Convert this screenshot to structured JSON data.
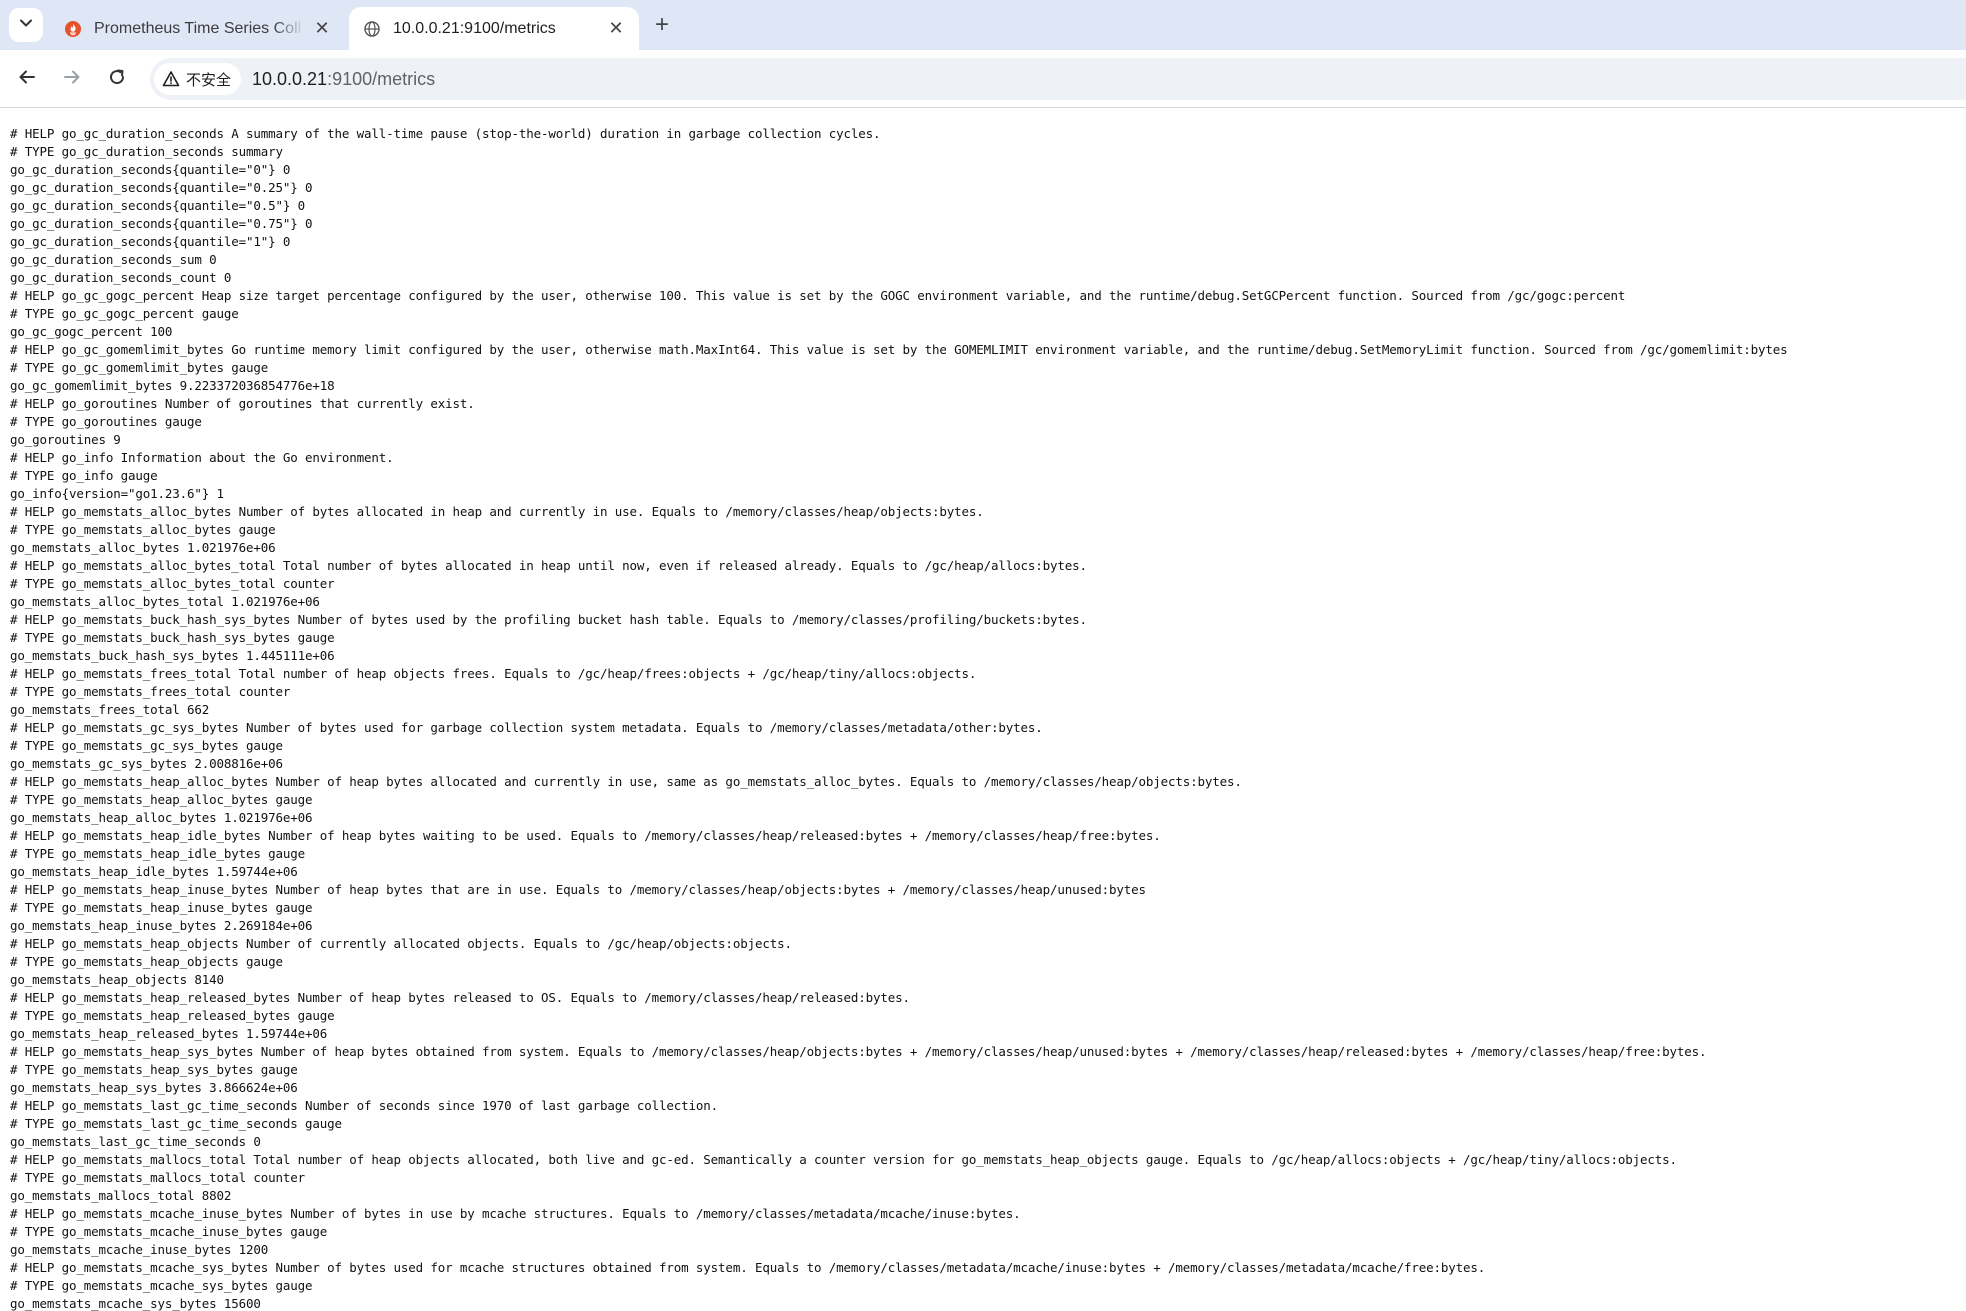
{
  "tabs": {
    "search_icon": "chevron-down-icon",
    "items": [
      {
        "title": "Prometheus Time Series Coll",
        "icon": "prometheus-flame-icon",
        "active": false
      },
      {
        "title": "10.0.0.21:9100/metrics",
        "icon": "globe-icon",
        "active": true
      }
    ],
    "close_glyph": "✕",
    "new_tab_glyph": "+"
  },
  "toolbar": {
    "back_icon": "arrow-left-icon",
    "forward_icon": "arrow-right-icon",
    "reload_icon": "reload-icon",
    "security_label": "不安全",
    "url_host": "10.0.0.21",
    "url_path": ":9100/metrics"
  },
  "page": {
    "lines": [
      "# HELP go_gc_duration_seconds A summary of the wall-time pause (stop-the-world) duration in garbage collection cycles.",
      "# TYPE go_gc_duration_seconds summary",
      "go_gc_duration_seconds{quantile=\"0\"} 0",
      "go_gc_duration_seconds{quantile=\"0.25\"} 0",
      "go_gc_duration_seconds{quantile=\"0.5\"} 0",
      "go_gc_duration_seconds{quantile=\"0.75\"} 0",
      "go_gc_duration_seconds{quantile=\"1\"} 0",
      "go_gc_duration_seconds_sum 0",
      "go_gc_duration_seconds_count 0",
      "# HELP go_gc_gogc_percent Heap size target percentage configured by the user, otherwise 100. This value is set by the GOGC environment variable, and the runtime/debug.SetGCPercent function. Sourced from /gc/gogc:percent",
      "# TYPE go_gc_gogc_percent gauge",
      "go_gc_gogc_percent 100",
      "# HELP go_gc_gomemlimit_bytes Go runtime memory limit configured by the user, otherwise math.MaxInt64. This value is set by the GOMEMLIMIT environment variable, and the runtime/debug.SetMemoryLimit function. Sourced from /gc/gomemlimit:bytes",
      "# TYPE go_gc_gomemlimit_bytes gauge",
      "go_gc_gomemlimit_bytes 9.223372036854776e+18",
      "# HELP go_goroutines Number of goroutines that currently exist.",
      "# TYPE go_goroutines gauge",
      "go_goroutines 9",
      "# HELP go_info Information about the Go environment.",
      "# TYPE go_info gauge",
      "go_info{version=\"go1.23.6\"} 1",
      "# HELP go_memstats_alloc_bytes Number of bytes allocated in heap and currently in use. Equals to /memory/classes/heap/objects:bytes.",
      "# TYPE go_memstats_alloc_bytes gauge",
      "go_memstats_alloc_bytes 1.021976e+06",
      "# HELP go_memstats_alloc_bytes_total Total number of bytes allocated in heap until now, even if released already. Equals to /gc/heap/allocs:bytes.",
      "# TYPE go_memstats_alloc_bytes_total counter",
      "go_memstats_alloc_bytes_total 1.021976e+06",
      "# HELP go_memstats_buck_hash_sys_bytes Number of bytes used by the profiling bucket hash table. Equals to /memory/classes/profiling/buckets:bytes.",
      "# TYPE go_memstats_buck_hash_sys_bytes gauge",
      "go_memstats_buck_hash_sys_bytes 1.445111e+06",
      "# HELP go_memstats_frees_total Total number of heap objects frees. Equals to /gc/heap/frees:objects + /gc/heap/tiny/allocs:objects.",
      "# TYPE go_memstats_frees_total counter",
      "go_memstats_frees_total 662",
      "# HELP go_memstats_gc_sys_bytes Number of bytes used for garbage collection system metadata. Equals to /memory/classes/metadata/other:bytes.",
      "# TYPE go_memstats_gc_sys_bytes gauge",
      "go_memstats_gc_sys_bytes 2.008816e+06",
      "# HELP go_memstats_heap_alloc_bytes Number of heap bytes allocated and currently in use, same as go_memstats_alloc_bytes. Equals to /memory/classes/heap/objects:bytes.",
      "# TYPE go_memstats_heap_alloc_bytes gauge",
      "go_memstats_heap_alloc_bytes 1.021976e+06",
      "# HELP go_memstats_heap_idle_bytes Number of heap bytes waiting to be used. Equals to /memory/classes/heap/released:bytes + /memory/classes/heap/free:bytes.",
      "# TYPE go_memstats_heap_idle_bytes gauge",
      "go_memstats_heap_idle_bytes 1.59744e+06",
      "# HELP go_memstats_heap_inuse_bytes Number of heap bytes that are in use. Equals to /memory/classes/heap/objects:bytes + /memory/classes/heap/unused:bytes",
      "# TYPE go_memstats_heap_inuse_bytes gauge",
      "go_memstats_heap_inuse_bytes 2.269184e+06",
      "# HELP go_memstats_heap_objects Number of currently allocated objects. Equals to /gc/heap/objects:objects.",
      "# TYPE go_memstats_heap_objects gauge",
      "go_memstats_heap_objects 8140",
      "# HELP go_memstats_heap_released_bytes Number of heap bytes released to OS. Equals to /memory/classes/heap/released:bytes.",
      "# TYPE go_memstats_heap_released_bytes gauge",
      "go_memstats_heap_released_bytes 1.59744e+06",
      "# HELP go_memstats_heap_sys_bytes Number of heap bytes obtained from system. Equals to /memory/classes/heap/objects:bytes + /memory/classes/heap/unused:bytes + /memory/classes/heap/released:bytes + /memory/classes/heap/free:bytes.",
      "# TYPE go_memstats_heap_sys_bytes gauge",
      "go_memstats_heap_sys_bytes 3.866624e+06",
      "# HELP go_memstats_last_gc_time_seconds Number of seconds since 1970 of last garbage collection.",
      "# TYPE go_memstats_last_gc_time_seconds gauge",
      "go_memstats_last_gc_time_seconds 0",
      "# HELP go_memstats_mallocs_total Total number of heap objects allocated, both live and gc-ed. Semantically a counter version for go_memstats_heap_objects gauge. Equals to /gc/heap/allocs:objects + /gc/heap/tiny/allocs:objects.",
      "# TYPE go_memstats_mallocs_total counter",
      "go_memstats_mallocs_total 8802",
      "# HELP go_memstats_mcache_inuse_bytes Number of bytes in use by mcache structures. Equals to /memory/classes/metadata/mcache/inuse:bytes.",
      "# TYPE go_memstats_mcache_inuse_bytes gauge",
      "go_memstats_mcache_inuse_bytes 1200",
      "# HELP go_memstats_mcache_sys_bytes Number of bytes used for mcache structures obtained from system. Equals to /memory/classes/metadata/mcache/inuse:bytes + /memory/classes/metadata/mcache/free:bytes.",
      "# TYPE go_memstats_mcache_sys_bytes gauge",
      "go_memstats_mcache_sys_bytes 15600"
    ]
  }
}
